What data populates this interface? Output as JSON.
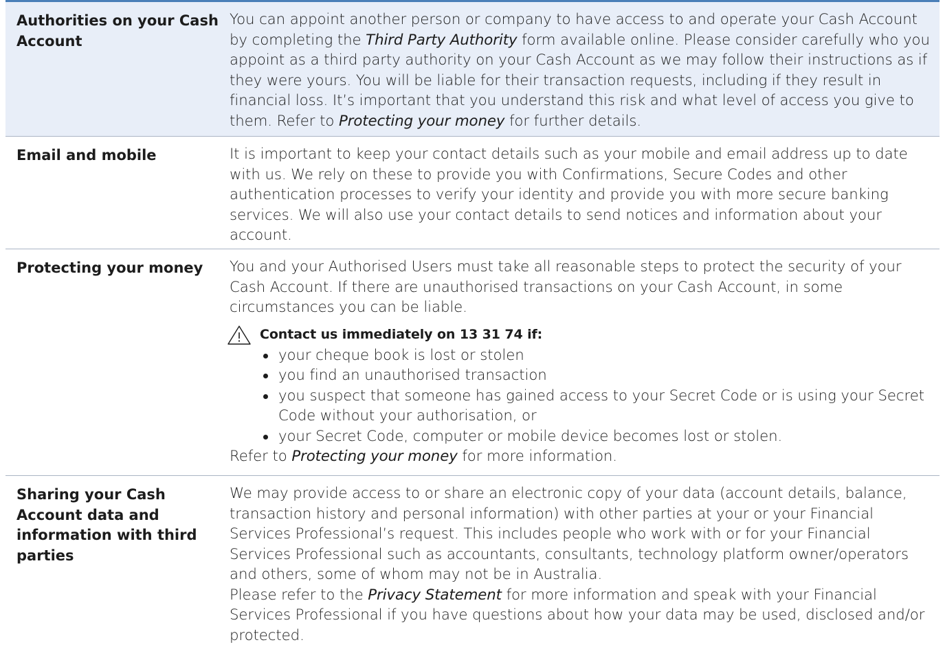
{
  "rows": [
    {
      "heading": "Authorities on your Cash Account",
      "text_a": "You can appoint another person or company to have access to and operate your Cash Account by completing the ",
      "italic_a": "Third Party Authority",
      "text_b": " form available online. Please consider carefully who you appoint as a third party authority on your Cash Account as we may follow their instructions as if they were yours. You will be liable for their transaction requests, including if they result in financial loss. It’s important that you understand this risk and what level of access you give to them. Refer to ",
      "italic_b": "Protecting your money",
      "text_c": " for further details."
    },
    {
      "heading": "Email and mobile",
      "text": "It is important to keep your contact details such as your mobile and email address up to date with us. We rely on these to provide you with Confirmations, Secure Codes and other authentication processes to verify your identity and provide you with more secure banking services. We will also use your contact details to send notices and information about your account."
    },
    {
      "heading": "Protecting your money",
      "text": "You and your Authorised Users must take all reasonable steps to protect the security of your Cash Account. If there are unauthorised transactions on your Cash Account, in some circumstances you can be liable.",
      "warning_title": "Contact us immediately on 13 31 74 if:",
      "bullets": [
        "your cheque book is lost or stolen",
        "you find an unauthorised transaction",
        "you suspect that someone has gained access to your Secret Code or is using your Secret Code without your authorisation, or",
        "your Secret Code, computer or mobile device becomes lost or stolen."
      ],
      "refer_a": "Refer to ",
      "refer_italic": "Protecting your money",
      "refer_b": " for more information."
    },
    {
      "heading": "Sharing your Cash Account data and information with third parties",
      "text": "We may provide access to or share an electronic copy of your data (account details, balance, transaction history and personal information) with other parties at your or your Financial Services Professional’s request. This includes people who work with or for your Financial Services Professional such as accountants, consultants, technology platform owner/operators and others, some of whom may not be in Australia.",
      "text2_a": "Please refer to the ",
      "text2_italic": "Privacy Statement",
      "text2_b": " for more information and speak with your Financial Services Professional if you have questions about how your data may be used, disclosed and/or protected."
    }
  ],
  "icons": {
    "warning": "warning-triangle-icon"
  },
  "colors": {
    "shade": "#e8eef8",
    "rule": "#4a7fb8"
  }
}
